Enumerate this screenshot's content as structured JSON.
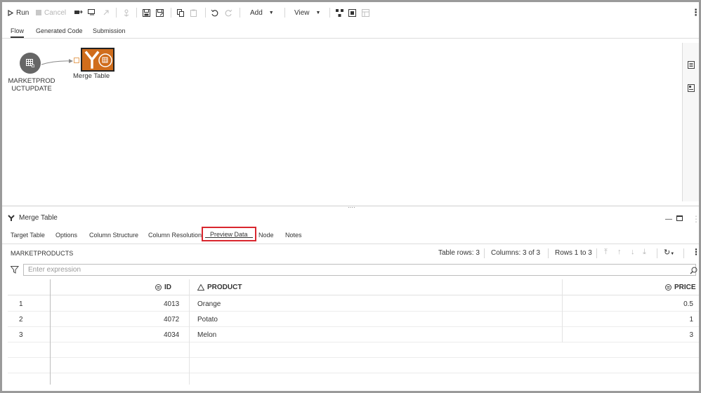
{
  "toolbar": {
    "run": "Run",
    "cancel": "Cancel",
    "add": "Add",
    "view": "View"
  },
  "top_tabs": [
    {
      "label": "Flow",
      "active": true
    },
    {
      "label": "Generated Code",
      "active": false
    },
    {
      "label": "Submission",
      "active": false
    }
  ],
  "flow": {
    "source_node": {
      "label_line1": "MARKETPROD",
      "label_line2": "UCTUPDATE"
    },
    "merge_node": {
      "label": "Merge Table",
      "color": "#d06d1c"
    }
  },
  "panel": {
    "title": "Merge Table",
    "tabs": [
      {
        "label": "Target Table"
      },
      {
        "label": "Options"
      },
      {
        "label": "Column Structure"
      },
      {
        "label": "Column Resolution"
      },
      {
        "label": "Preview Data",
        "active": true
      },
      {
        "label": "Node"
      },
      {
        "label": "Notes"
      }
    ],
    "highlight_color": "#d9262e"
  },
  "preview": {
    "table_name": "MARKETPRODUCTS",
    "table_rows": "Table rows: 3",
    "columns": "Columns: 3 of 3",
    "rows_range": "Rows 1 to 3",
    "filter_placeholder": "Enter expression",
    "headers": [
      "ID",
      "PRODUCT",
      "PRICE"
    ],
    "rows": [
      {
        "n": "1",
        "id": "4013",
        "product": "Orange",
        "price": "0.5"
      },
      {
        "n": "2",
        "id": "4072",
        "product": "Potato",
        "price": "1"
      },
      {
        "n": "3",
        "id": "4034",
        "product": "Melon",
        "price": "3"
      }
    ]
  }
}
